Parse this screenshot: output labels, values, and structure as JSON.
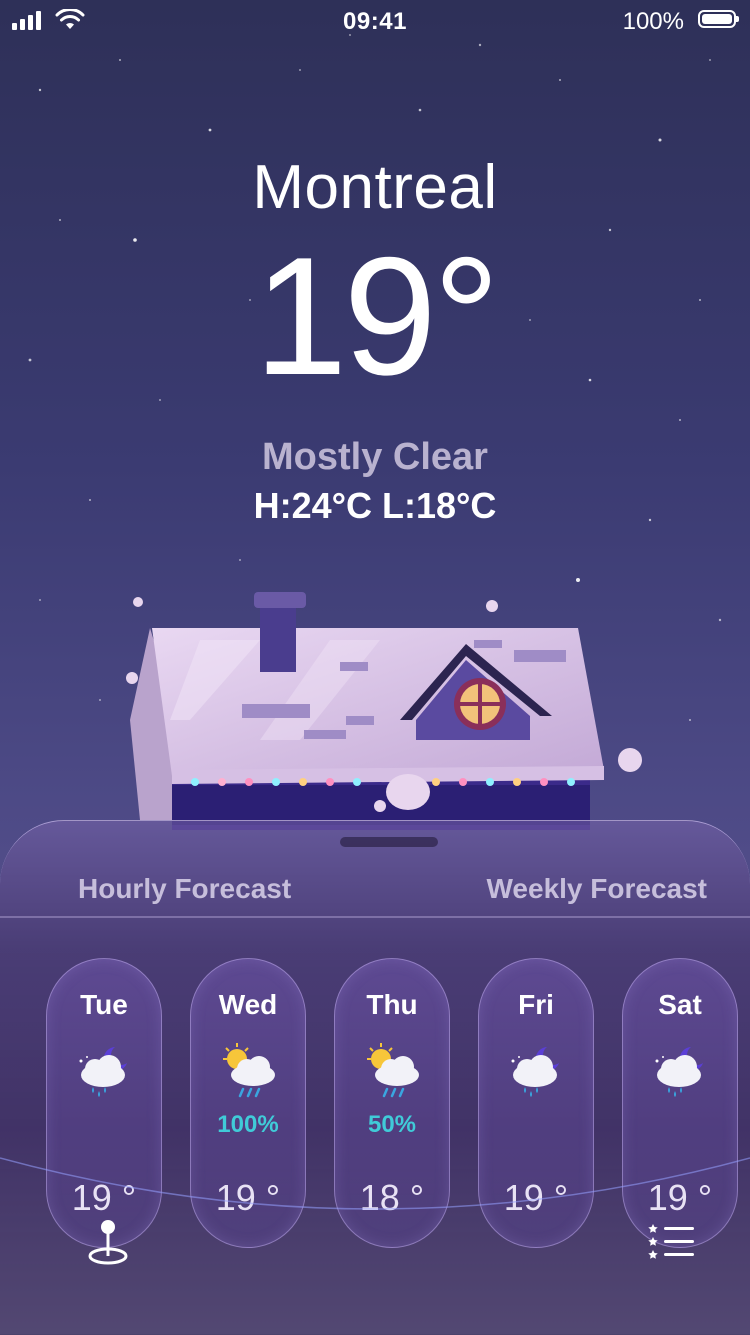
{
  "status_bar": {
    "time": "09:41",
    "battery": "100%"
  },
  "weather": {
    "city": "Montreal",
    "temperature": "19°",
    "condition": "Mostly Clear",
    "high_low": "H:24°C L:18°C"
  },
  "tabs": {
    "hourly": "Hourly Forecast",
    "weekly": "Weekly Forecast"
  },
  "forecast": [
    {
      "day": "Tue",
      "icon": "night-rain-icon",
      "precip": "",
      "temp": "19 °"
    },
    {
      "day": "Wed",
      "icon": "sun-rain-icon",
      "precip": "100%",
      "temp": "19 °"
    },
    {
      "day": "Thu",
      "icon": "sun-rain-icon",
      "precip": "50%",
      "temp": "18 °"
    },
    {
      "day": "Fri",
      "icon": "night-rain-icon",
      "precip": "",
      "temp": "19 °"
    },
    {
      "day": "Sat",
      "icon": "night-rain-icon",
      "precip": "",
      "temp": "19 °"
    }
  ],
  "colors": {
    "precip": "#40cbd8",
    "accent": "#b9b2cf"
  }
}
